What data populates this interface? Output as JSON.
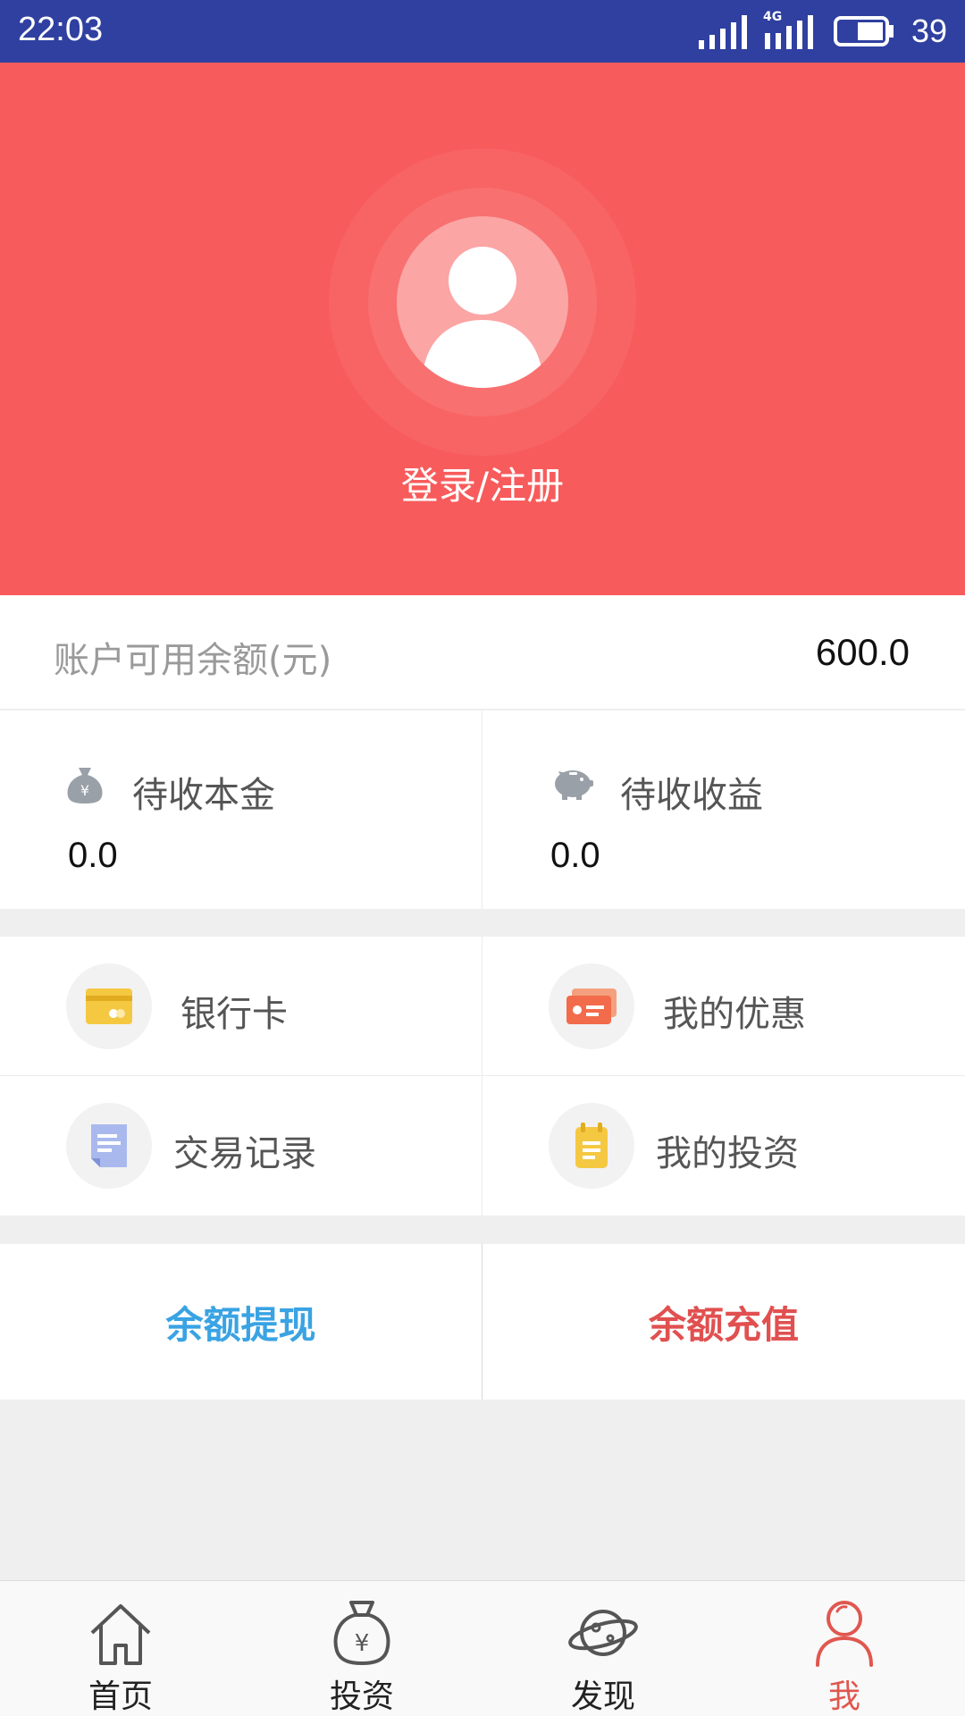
{
  "status_bar": {
    "time": "22:03",
    "network": "4G",
    "battery": "39"
  },
  "header": {
    "login_text": "登录/注册"
  },
  "balance": {
    "label": "账户可用余额(元)",
    "value": "600.0"
  },
  "pending": {
    "principal": {
      "label": "待收本金",
      "value": "0.0",
      "icon": "money-bag-icon"
    },
    "earnings": {
      "label": "待收收益",
      "value": "0.0",
      "icon": "piggy-bank-icon"
    }
  },
  "menu": {
    "bank_card": {
      "label": "银行卡",
      "icon": "bank-card-icon",
      "color": "#f5c842"
    },
    "coupons": {
      "label": "我的优惠",
      "icon": "coupon-icon",
      "color": "#f26b4a"
    },
    "transactions": {
      "label": "交易记录",
      "icon": "document-icon",
      "color": "#a9b9ee"
    },
    "investments": {
      "label": "我的投资",
      "icon": "clipboard-icon",
      "color": "#f5c842"
    }
  },
  "actions": {
    "withdraw": {
      "label": "余额提现",
      "color": "#3aa3e3"
    },
    "recharge": {
      "label": "余额充值",
      "color": "#e15050"
    }
  },
  "tabs": [
    {
      "label": "首页",
      "icon": "home-icon"
    },
    {
      "label": "投资",
      "icon": "money-bag-icon"
    },
    {
      "label": "发现",
      "icon": "planet-icon"
    },
    {
      "label": "我",
      "icon": "user-icon",
      "active": true
    }
  ],
  "colors": {
    "header_bg": "#f85b5b",
    "status_bg": "#2f40a0",
    "active_tab": "#e0574f"
  }
}
